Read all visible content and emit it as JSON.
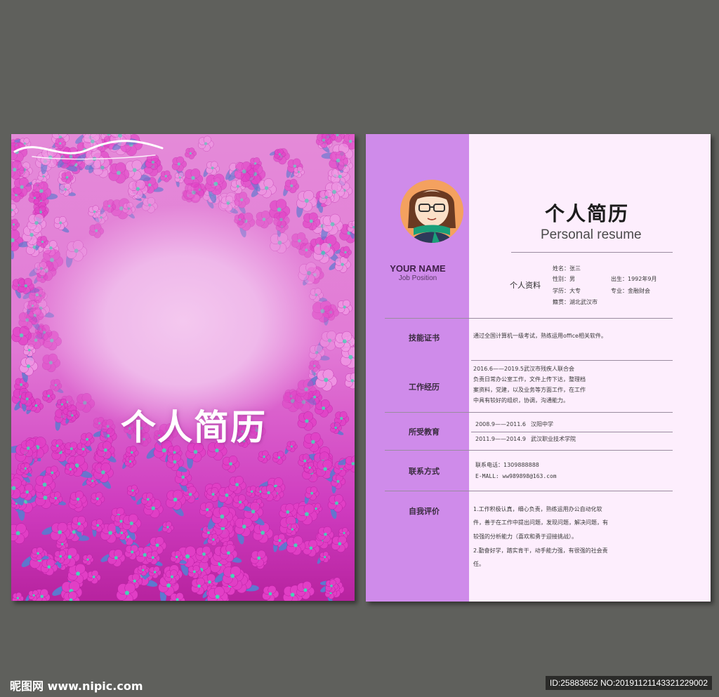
{
  "cover": {
    "title": "个人简历",
    "colors": {
      "flower": "#e23fc6",
      "flower_light": "#f29be6",
      "leaf": "#5c7ad0",
      "center": "#46d6b8"
    }
  },
  "resume": {
    "your_name": "YOUR NAME",
    "job_position": "Job Position",
    "title_cn": "个人简历",
    "title_en": "Personal resume",
    "personal_info": {
      "label": "个人资料",
      "name": "姓名：张三",
      "gender": "性别：男",
      "birth": "出生：1992年9月",
      "education": "学历：大专",
      "major": "专业：金融财会",
      "native_place": "籍贯：湖北武汉市"
    },
    "sections": {
      "skills": {
        "label": "技能证书",
        "text": "通过全国计算机一级考试，熟练运用office相关软件。"
      },
      "work": {
        "label": "工作经历",
        "lines": [
          "2016.6——2019.5武汉市残疾人联合会",
          "负责日常办公室工作，文件上传下达，整理档",
          "案资料，党建，以及业务等方面工作，在工作",
          "中具有较好的组织，协调，沟通能力。"
        ]
      },
      "education": {
        "label": "所受教育",
        "rows": [
          {
            "period": "2008.9——2011.6",
            "school": "汉阳中学"
          },
          {
            "period": "2011.9——2014.9",
            "school": "武汉职业技术学院"
          }
        ]
      },
      "contact": {
        "label": "联系方式",
        "phone": "联系电话：1309888888",
        "email": "E-MALL: ww989898@163.com"
      },
      "self_eval": {
        "label": "自我评价",
        "lines": [
          "1.工作积极认真，细心负责，熟练运用办公自动化软",
          "件，善于在工作中提出问题，发现问题，解决问题，有",
          "较强的分析能力（喜欢和勇于迎接挑战）。",
          "2.勤奋好学，踏实肯干，动手能力强，有很强的社会责",
          "任。"
        ]
      }
    },
    "colors": {
      "sidebar": "#cf8bea",
      "page": "#fdeefd"
    }
  },
  "watermark": {
    "left": "昵图网 www.nipic.com",
    "right": "ID:25883652 NO:20191121143321229002"
  }
}
